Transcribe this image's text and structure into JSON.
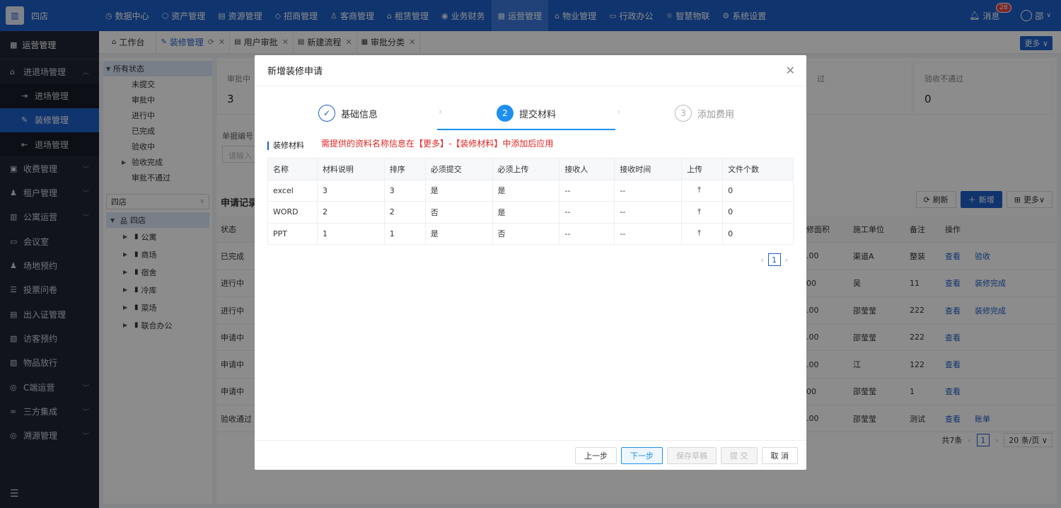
{
  "app": {
    "logo_text": "四店"
  },
  "top_menu": [
    {
      "label": "数据中心",
      "icon": "dashboard-icon"
    },
    {
      "label": "资产管理",
      "icon": "box-icon"
    },
    {
      "label": "资源管理",
      "icon": "building-icon"
    },
    {
      "label": "招商管理",
      "icon": "tag-icon"
    },
    {
      "label": "客商管理",
      "icon": "users-icon"
    },
    {
      "label": "租赁管理",
      "icon": "home-icon"
    },
    {
      "label": "业务财务",
      "icon": "coin-icon"
    },
    {
      "label": "运营管理",
      "icon": "grid-icon",
      "active": true
    },
    {
      "label": "物业管理",
      "icon": "house-icon"
    },
    {
      "label": "行政办公",
      "icon": "monitor-icon"
    },
    {
      "label": "智慧物联",
      "icon": "sun-icon"
    },
    {
      "label": "系统设置",
      "icon": "gear-icon"
    }
  ],
  "top_right": {
    "messages_label": "消息",
    "messages_count": "28",
    "user_name": "邵"
  },
  "sidebar": {
    "title": "运营管理",
    "items": [
      {
        "label": "进退场管理",
        "icon": "door-icon",
        "chevron": "^"
      },
      {
        "label": "进场管理",
        "icon": "login-icon",
        "sub": true
      },
      {
        "label": "装修管理",
        "icon": "brush-icon",
        "sub": true,
        "active": true
      },
      {
        "label": "退场管理",
        "icon": "logout-icon",
        "sub": true
      },
      {
        "label": "收费管理",
        "icon": "wallet-icon",
        "chevron": "v"
      },
      {
        "label": "租户管理",
        "icon": "user-icon",
        "chevron": "v"
      },
      {
        "label": "公寓运营",
        "icon": "apartment-icon",
        "chevron": "v"
      },
      {
        "label": "会议室",
        "icon": "meeting-icon"
      },
      {
        "label": "场地预约",
        "icon": "location-icon"
      },
      {
        "label": "投票问卷",
        "icon": "vote-icon"
      },
      {
        "label": "出入证管理",
        "icon": "badge-icon"
      },
      {
        "label": "访客预约",
        "icon": "visitor-icon"
      },
      {
        "label": "物品放行",
        "icon": "package-icon"
      },
      {
        "label": "C端运营",
        "icon": "c-icon",
        "chevron": "v"
      },
      {
        "label": "三方集成",
        "icon": "link-icon",
        "chevron": "v"
      },
      {
        "label": "溯源管理",
        "icon": "trace-icon",
        "chevron": "v"
      }
    ]
  },
  "tabs": [
    {
      "label": "工作台",
      "icon": "home-icon"
    },
    {
      "label": "装修管理",
      "icon": "brush-icon",
      "active": true,
      "refresh": true
    },
    {
      "label": "用户审批",
      "icon": "doc-icon"
    },
    {
      "label": "新建流程",
      "icon": "doc-icon"
    },
    {
      "label": "审批分类",
      "icon": "grid-icon"
    }
  ],
  "tabs_more": "更多",
  "status_tree": {
    "root": "所有状态",
    "items": [
      "未提交",
      "审批中",
      "进行中",
      "已完成",
      "验收中",
      "验收完成",
      "审批不通过"
    ]
  },
  "store_select": "四店",
  "store_tree": {
    "root": "四店",
    "children": [
      "公寓",
      "商场",
      "宿舍",
      "冷库",
      "菜场",
      "联合办公"
    ]
  },
  "stats": {
    "first": {
      "label": "审批中",
      "value": "3"
    },
    "mid_label_tail": "过",
    "last": {
      "label": "验收不通过",
      "value": "0"
    }
  },
  "filters": {
    "order_no_label": "单据编号",
    "order_no_placeholder": "请输入"
  },
  "list": {
    "title": "申请记录",
    "refresh": "刷新",
    "add": "新增",
    "more": "更多",
    "headers": {
      "status": "状态",
      "area": "修面积",
      "unit": "施工单位",
      "note": "备注",
      "ops": "操作"
    },
    "rows": [
      {
        "status": "已完成",
        "area": ".00",
        "unit": "渠道A",
        "note": "整装",
        "ops": [
          "查看",
          "验收"
        ]
      },
      {
        "status": "进行中",
        "area": "00",
        "unit": "吴",
        "note": "11",
        "ops": [
          "查看",
          "装修完成"
        ]
      },
      {
        "status": "进行中",
        "area": ".00",
        "unit": "邵莹莹",
        "note": "222",
        "ops": [
          "查看",
          "装修完成"
        ]
      },
      {
        "status": "申请中",
        "area": ".00",
        "unit": "邵莹莹",
        "note": "222",
        "ops": [
          "查看"
        ]
      },
      {
        "status": "申请中",
        "area": ".00",
        "unit": "江",
        "note": "122",
        "ops": [
          "查看"
        ]
      },
      {
        "status": "申请中",
        "area": "00",
        "unit": "邵莹莹",
        "note": "1",
        "ops": [
          "查看"
        ]
      },
      {
        "status": "验收通过",
        "area": ".00",
        "unit": "邵莹莹",
        "note": "测试",
        "ops": [
          "查看",
          "账单"
        ]
      }
    ],
    "total": "共7条",
    "page": "1",
    "page_size": "20 条/页"
  },
  "modal": {
    "title": "新增装修申请",
    "steps": [
      {
        "num": "✓",
        "label": "基础信息",
        "state": "done"
      },
      {
        "num": "2",
        "label": "提交材料",
        "state": "active"
      },
      {
        "num": "3",
        "label": "添加费用",
        "state": "wait"
      }
    ],
    "section_title": "装修材料",
    "hint": "需提供的资料名称信息在【更多】-【装修材料】中添加后应用",
    "table": {
      "headers": [
        "名称",
        "材料说明",
        "排序",
        "必须提交",
        "必须上传",
        "接收人",
        "接收时间",
        "上传",
        "文件个数"
      ],
      "rows": [
        [
          "excel",
          "3",
          "3",
          "是",
          "是",
          "--",
          "--",
          "⤒",
          "0"
        ],
        [
          "WORD",
          "2",
          "2",
          "否",
          "是",
          "--",
          "--",
          "⤒",
          "0"
        ],
        [
          "PPT",
          "1",
          "1",
          "是",
          "否",
          "--",
          "--",
          "⤒",
          "0"
        ]
      ]
    },
    "pager": {
      "page": "1"
    },
    "footer": {
      "prev": "上一步",
      "next": "下一步",
      "save_draft": "保存草稿",
      "submit": "提 交",
      "cancel": "取 消"
    }
  }
}
